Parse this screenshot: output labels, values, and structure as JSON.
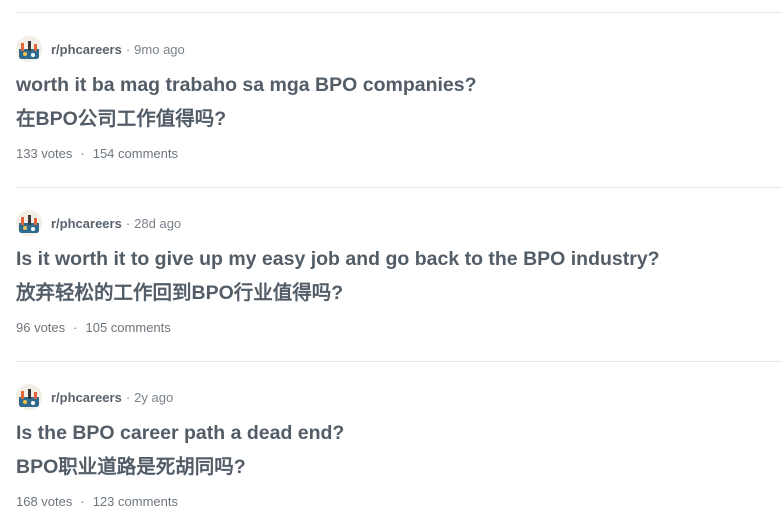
{
  "posts": [
    {
      "subreddit": "r/phcareers",
      "separator": "·",
      "age": "9mo ago",
      "title": "worth it ba mag trabaho sa mga BPO companies?",
      "translation": "在BPO公司工作值得吗?",
      "votes": "133 votes",
      "stats_separator": "·",
      "comments": "154 comments",
      "avatar_icon": "subreddit-avatar-icon"
    },
    {
      "subreddit": "r/phcareers",
      "separator": "·",
      "age": "28d ago",
      "title": "Is it worth it to give up my easy job and go back to the BPO industry?",
      "translation": "放弃轻松的工作回到BPO行业值得吗?",
      "votes": "96 votes",
      "stats_separator": "·",
      "comments": "105 comments",
      "avatar_icon": "subreddit-avatar-icon"
    },
    {
      "subreddit": "r/phcareers",
      "separator": "·",
      "age": "2y ago",
      "title": "Is the BPO career path a dead end?",
      "translation": "BPO职业道路是死胡同吗?",
      "votes": "168 votes",
      "stats_separator": "·",
      "comments": "123 comments",
      "avatar_icon": "subreddit-avatar-icon"
    }
  ],
  "colors": {
    "text": "#535d67",
    "meta": "#7a828a",
    "divider": "#e6e8ea",
    "avatar_sky": "#2f6b8f",
    "avatar_accent": "#e0663a"
  }
}
